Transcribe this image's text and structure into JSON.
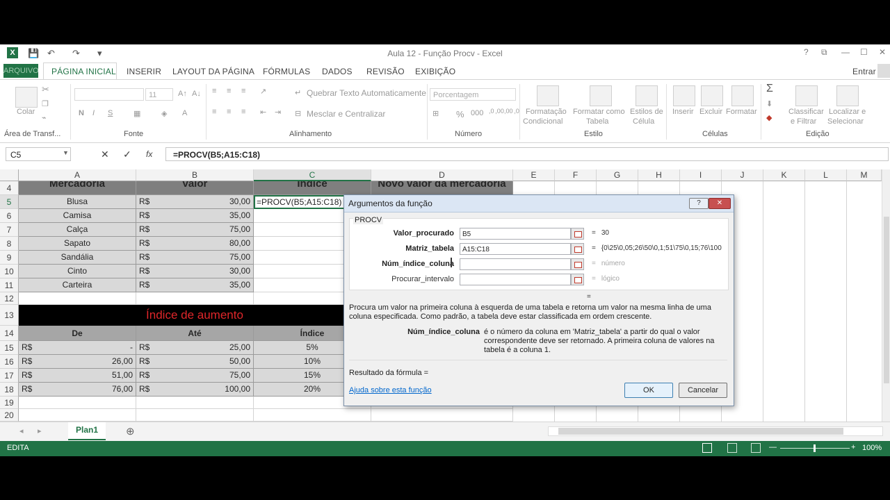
{
  "window": {
    "title": "Aula 12 - Função Procv - Excel",
    "user": "Entrar",
    "help": "?",
    "restore": "⧉",
    "minimize": "—",
    "maximize": "☐",
    "close": "✕"
  },
  "quick_access": {
    "app_icon": "X",
    "save": "💾",
    "undo": "↶",
    "redo": "↷",
    "more": "▾"
  },
  "tabs": [
    "ARQUIVO",
    "PÁGINA INICIAL",
    "INSERIR",
    "LAYOUT DA PÁGINA",
    "FÓRMULAS",
    "DADOS",
    "REVISÃO",
    "EXIBIÇÃO"
  ],
  "ribbon": {
    "groups": [
      "Área de Transf...",
      "Fonte",
      "Alinhamento",
      "Número",
      "Estilo",
      "Células",
      "Edição"
    ],
    "paste": "Colar",
    "font_size": "11",
    "bold": "N",
    "italic": "I",
    "underline": "S",
    "wrap_text": "Quebrar Texto Automaticamente",
    "merge_center": "Mesclar e Centralizar",
    "number_format": "Porcentagem",
    "percent": "%",
    "thousands": "000",
    "inc_dec": ",0 ,00",
    "dec_dec": ",00 ,0",
    "cond_format_1": "Formatação",
    "cond_format_2": "Condicional",
    "table_format_1": "Formatar como",
    "table_format_2": "Tabela",
    "cell_styles_1": "Estilos de",
    "cell_styles_2": "Célula",
    "insert": "Inserir",
    "delete": "Excluir",
    "format": "Formatar",
    "sort_1": "Classificar",
    "sort_2": "e Filtrar",
    "find_1": "Localizar e",
    "find_2": "Selecionar",
    "sum": "Σ"
  },
  "formula_bar": {
    "name_box": "C5",
    "cancel": "✕",
    "enter": "✓",
    "fx": "fx",
    "formula": "=PROCV(B5;A15:C18)"
  },
  "columns": [
    "A",
    "B",
    "C",
    "D",
    "E",
    "F",
    "G",
    "H",
    "I",
    "J",
    "K",
    "L",
    "M"
  ],
  "rows": [
    "4",
    "5",
    "6",
    "7",
    "8",
    "9",
    "10",
    "11",
    "12",
    "13",
    "14",
    "15",
    "16",
    "17",
    "18",
    "19",
    "20"
  ],
  "header_row4": {
    "a": "Mercadoria",
    "b": "Valor",
    "c": "Índice",
    "d": "Novo valor da mercadoria"
  },
  "products": [
    {
      "name": "Blusa",
      "cur": "R$",
      "value": "30,00"
    },
    {
      "name": "Camisa",
      "cur": "R$",
      "value": "35,00"
    },
    {
      "name": "Calça",
      "cur": "R$",
      "value": "75,00"
    },
    {
      "name": "Sapato",
      "cur": "R$",
      "value": "80,00"
    },
    {
      "name": "Sandália",
      "cur": "R$",
      "value": "75,00"
    },
    {
      "name": "Cinto",
      "cur": "R$",
      "value": "30,00"
    },
    {
      "name": "Carteira",
      "cur": "R$",
      "value": "35,00"
    }
  ],
  "active_cell_text": "=PROCV(B5;A15:C18)",
  "increase_table": {
    "title": "Índice de aumento",
    "headers": {
      "from": "De",
      "to": "Até",
      "index": "Índice"
    },
    "rows": [
      {
        "from_cur": "R$",
        "from": "-",
        "to_cur": "R$",
        "to": "25,00",
        "index": "5%"
      },
      {
        "from_cur": "R$",
        "from": "26,00",
        "to_cur": "R$",
        "to": "50,00",
        "index": "10%"
      },
      {
        "from_cur": "R$",
        "from": "51,00",
        "to_cur": "R$",
        "to": "75,00",
        "index": "15%"
      },
      {
        "from_cur": "R$",
        "from": "76,00",
        "to_cur": "R$",
        "to": "100,00",
        "index": "20%"
      }
    ]
  },
  "dialog": {
    "title": "Argumentos da função",
    "help_btn": "?",
    "close_btn": "✕",
    "function_name": "PROCV",
    "args": [
      {
        "label": "Valor_procurado",
        "value": "B5",
        "result": "30",
        "bold": true
      },
      {
        "label": "Matriz_tabela",
        "value": "A15:C18",
        "result": "{0\\25\\0,05;26\\50\\0,1;51\\75\\0,15;76\\100",
        "bold": true
      },
      {
        "label": "Núm_índice_coluna",
        "value": "",
        "result": "número",
        "bold": true
      },
      {
        "label": "Procurar_intervalo",
        "value": "",
        "result": "lógico",
        "bold": false
      }
    ],
    "equals": "=",
    "description": "Procura um valor na primeira coluna à esquerda de uma tabela e retorna um valor na mesma linha de uma coluna especificada. Como padrão, a tabela deve estar classificada em ordem crescente.",
    "arg_help_label": "Núm_índice_coluna",
    "arg_help_text": "é o número da coluna em 'Matriz_tabela' a partir do qual o valor correspondente deve ser retornado. A primeira coluna de valores na tabela é a coluna 1.",
    "formula_result": "Resultado da fórmula =",
    "help_link": "Ajuda sobre esta função",
    "ok": "OK",
    "cancel": "Cancelar"
  },
  "sheet_tabs": {
    "prev": "◂",
    "next": "▸",
    "active": "Plan1",
    "add": "⊕"
  },
  "status": {
    "mode": "EDITA",
    "zoom": "100%",
    "zoom_minus": "—",
    "zoom_plus": "+"
  }
}
